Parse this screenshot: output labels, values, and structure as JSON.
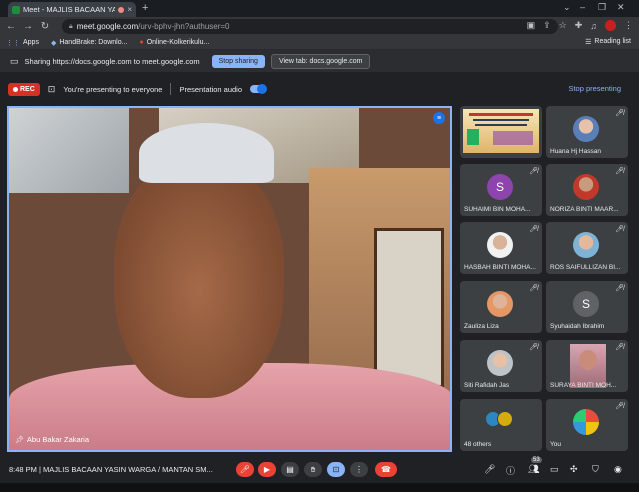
{
  "browser": {
    "tab_title": "Meet - MAJLIS BACAAN YA",
    "tab_close": "×",
    "new_tab": "+",
    "window_controls": [
      "⌄",
      "–",
      "❐",
      "✕"
    ],
    "url_host": "meet.google.com",
    "url_path": "/urv-bphv-jhn?authuser=0",
    "bookmarks": [
      {
        "label": "Apps",
        "icon": "apps-grid-icon"
      },
      {
        "label": "HandBrake: Downlo...",
        "icon": "handbrake-icon"
      },
      {
        "label": "Online-Kolkerikulu...",
        "icon": "bookmark-icon"
      }
    ],
    "reading_list": "Reading list"
  },
  "sharing_bar": {
    "text": "Sharing https://docs.google.com to meet.google.com",
    "stop_sharing": "Stop sharing",
    "view_tab": "View tab: docs.google.com"
  },
  "presenting_bar": {
    "rec": "REC",
    "status": "You're presenting to everyone",
    "presentation_audio": "Presentation audio",
    "stop_presenting": "Stop presenting"
  },
  "main_speaker": {
    "name": "Abu Bakar Zakaria"
  },
  "participants": [
    {
      "name": "",
      "kind": "slide"
    },
    {
      "name": "Huana Hj Hassan",
      "kind": "photo"
    },
    {
      "name": "SUHAIMI BIN MOHA...",
      "kind": "letter",
      "letter": "S"
    },
    {
      "name": "NORIZA BINTI MAAR...",
      "kind": "photo"
    },
    {
      "name": "HASBAH BINTI MOHA...",
      "kind": "photo"
    },
    {
      "name": "ROS SAIFULLIZAN BI...",
      "kind": "photo"
    },
    {
      "name": "Zauliza Liza",
      "kind": "photo"
    },
    {
      "name": "Syuhaidah Ibrahim",
      "kind": "letter",
      "letter": "S"
    },
    {
      "name": "Siti Rafidah Jas",
      "kind": "photo"
    },
    {
      "name": "SURAYA BINTI MOH...",
      "kind": "video"
    },
    {
      "name": "48 others",
      "kind": "others"
    },
    {
      "name": "You",
      "kind": "you"
    }
  ],
  "bottom_bar": {
    "time_and_title": "8:48 PM  |  MAJLIS BACAAN YASIN WARGA / MANTAN SM...",
    "participant_count": "53"
  }
}
